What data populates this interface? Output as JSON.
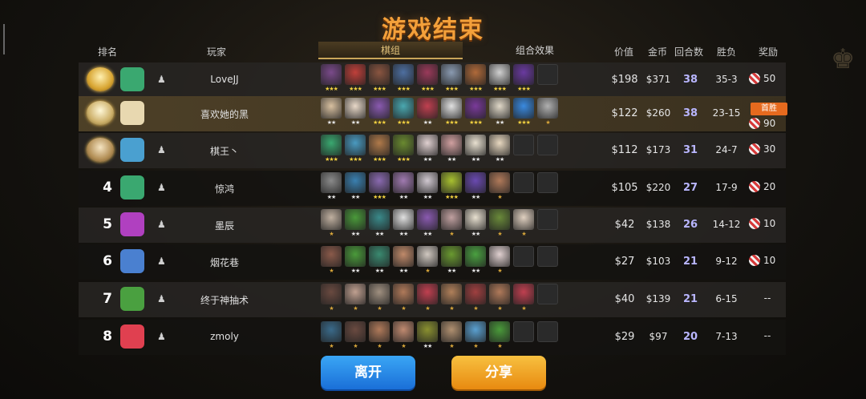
{
  "title": "游戏结束",
  "headers": {
    "rank": "排名",
    "player": "玩家",
    "value": "价值",
    "gold": "金币",
    "rounds": "回合数",
    "winloss": "胜负",
    "reward": "奖励"
  },
  "tabs": [
    {
      "label": "棋组",
      "active": true
    },
    {
      "label": "组合效果",
      "active": false
    }
  ],
  "first_win_label": "首胜",
  "players": [
    {
      "rank": "",
      "name": "LoveJJ",
      "value": "$198",
      "gold": "$371",
      "rounds": "38",
      "winloss": "35-3",
      "reward": "50",
      "units": [
        3,
        3,
        3,
        3,
        3,
        3,
        3,
        3,
        3,
        0
      ],
      "colors": [
        "#7a4a8a",
        "#c0403a",
        "#8a5540",
        "#4e6fa0",
        "#9a3a5a",
        "#8a9ab0",
        "#b06a3a",
        "#d0d0d0",
        "#6a3aa0",
        "#2a2a2a"
      ]
    },
    {
      "rank": "",
      "name": "喜欢她的黑",
      "value": "$122",
      "gold": "$260",
      "rounds": "38",
      "winloss": "23-15",
      "reward": "90",
      "first_win": true,
      "units": [
        2,
        2,
        3,
        3,
        2,
        3,
        3,
        2,
        3,
        1
      ],
      "colors": [
        "#d8c0a0",
        "#e8d8c8",
        "#8a5ab0",
        "#4aa8b0",
        "#c04050",
        "#e0e0e0",
        "#7a3a9a",
        "#e0d8c8",
        "#3a8ae0",
        "#b0b0b0"
      ]
    },
    {
      "rank": "",
      "name": "棋王丶",
      "value": "$112",
      "gold": "$173",
      "rounds": "31",
      "winloss": "24-7",
      "reward": "30",
      "units": [
        3,
        3,
        3,
        3,
        2,
        2,
        2,
        2,
        0,
        0
      ],
      "colors": [
        "#3aa870",
        "#4a9ac0",
        "#b07a4a",
        "#6a8a30",
        "#e0d0d0",
        "#d0a0a0",
        "#e8e0d0",
        "#e8d8c0",
        "#2a2a2a",
        "#2a2a2a"
      ]
    },
    {
      "rank": "4",
      "name": "惊鸿",
      "value": "$105",
      "gold": "$220",
      "rounds": "27",
      "winloss": "17-9",
      "reward": "20",
      "units": [
        2,
        2,
        3,
        2,
        2,
        3,
        2,
        1,
        0,
        0
      ],
      "colors": [
        "#8a8a8a",
        "#3a80b0",
        "#8a6ab0",
        "#a07ab0",
        "#d0c8d0",
        "#a8c030",
        "#6a4ab0",
        "#b07a5a",
        "#2a2a2a",
        "#2a2a2a"
      ]
    },
    {
      "rank": "5",
      "name": "墨辰",
      "value": "$42",
      "gold": "$138",
      "rounds": "26",
      "winloss": "14-12",
      "reward": "10",
      "units": [
        1,
        2,
        2,
        2,
        2,
        1,
        2,
        1,
        1,
        0
      ],
      "colors": [
        "#c0b0a0",
        "#4a9a3a",
        "#3a8a8a",
        "#e0e0e0",
        "#8a5ab0",
        "#c0a0a0",
        "#e8e0d0",
        "#6a8a3a",
        "#e0d0c0",
        "#2a2a2a"
      ]
    },
    {
      "rank": "6",
      "name": "烟花巷",
      "value": "$27",
      "gold": "$103",
      "rounds": "21",
      "winloss": "9-12",
      "reward": "10",
      "units": [
        1,
        2,
        2,
        2,
        1,
        2,
        2,
        1,
        0,
        0
      ],
      "colors": [
        "#8a5a4a",
        "#4a9a3a",
        "#3a8a70",
        "#c08a6a",
        "#d0c8c0",
        "#6a9a30",
        "#4aa040",
        "#e0d0d0",
        "#2a2a2a",
        "#2a2a2a"
      ]
    },
    {
      "rank": "7",
      "name": "终于神抽术",
      "value": "$40",
      "gold": "$139",
      "rounds": "21",
      "winloss": "6-15",
      "reward": "--",
      "units": [
        1,
        1,
        1,
        1,
        1,
        1,
        1,
        1,
        1,
        0
      ],
      "colors": [
        "#6a4a40",
        "#c0a090",
        "#a09080",
        "#b07a5a",
        "#c04050",
        "#b0805a",
        "#a04040",
        "#b07a5a",
        "#c04050",
        "#2a2a2a"
      ]
    },
    {
      "rank": "8",
      "name": "zmoly",
      "value": "$29",
      "gold": "$97",
      "rounds": "20",
      "winloss": "7-13",
      "reward": "--",
      "units": [
        1,
        1,
        1,
        1,
        2,
        1,
        1,
        1,
        0,
        0
      ],
      "colors": [
        "#3a6a8a",
        "#6a4a40",
        "#b07a5a",
        "#c08a70",
        "#8a9030",
        "#b09070",
        "#5aa0d0",
        "#4a9a3a",
        "#2a2a2a",
        "#2a2a2a"
      ]
    }
  ],
  "buttons": {
    "leave": "离开",
    "share": "分享"
  },
  "colors": {
    "accent": "#f3a03a",
    "rounds": "#b9b6ff",
    "leave": "#2a8ae8",
    "share": "#f0a020"
  }
}
